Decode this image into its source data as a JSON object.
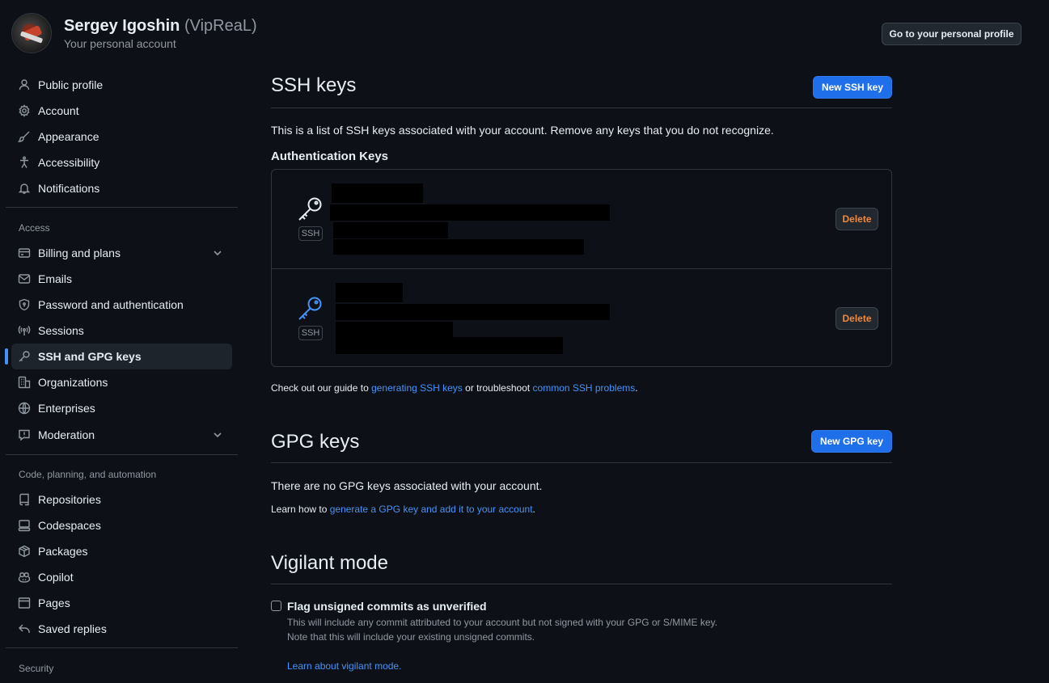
{
  "header": {
    "name": "Sergey Igoshin",
    "login": "(VipReaL)",
    "subtitle": "Your personal account",
    "profile_button": "Go to your personal profile"
  },
  "sidebar": {
    "items": [
      {
        "label": "Public profile",
        "icon": "person-icon"
      },
      {
        "label": "Account",
        "icon": "gear-icon"
      },
      {
        "label": "Appearance",
        "icon": "paintbrush-icon"
      },
      {
        "label": "Accessibility",
        "icon": "accessibility-icon"
      },
      {
        "label": "Notifications",
        "icon": "bell-icon"
      }
    ],
    "access_header": "Access",
    "access_items": [
      {
        "label": "Billing and plans",
        "icon": "credit-card-icon"
      },
      {
        "label": "Emails",
        "icon": "mail-icon"
      },
      {
        "label": "Password and authentication",
        "icon": "shield-lock-icon"
      },
      {
        "label": "Sessions",
        "icon": "broadcast-icon"
      },
      {
        "label": "SSH and GPG keys",
        "icon": "key-icon"
      },
      {
        "label": "Organizations",
        "icon": "organization-icon"
      },
      {
        "label": "Enterprises",
        "icon": "globe-icon"
      },
      {
        "label": "Moderation",
        "icon": "report-icon"
      }
    ],
    "code_header": "Code, planning, and automation",
    "code_items": [
      {
        "label": "Repositories",
        "icon": "repo-icon"
      },
      {
        "label": "Codespaces",
        "icon": "codespaces-icon"
      },
      {
        "label": "Packages",
        "icon": "package-icon"
      },
      {
        "label": "Copilot",
        "icon": "copilot-icon"
      },
      {
        "label": "Pages",
        "icon": "browser-icon"
      },
      {
        "label": "Saved replies",
        "icon": "reply-icon"
      }
    ],
    "security_header": "Security"
  },
  "ssh": {
    "title": "SSH keys",
    "new_button": "New SSH key",
    "description": "This is a list of SSH keys associated with your account. Remove any keys that you do not recognize.",
    "auth_header": "Authentication Keys",
    "keys": [
      {
        "badge": "SSH",
        "delete_label": "Delete",
        "icon_color": "#e6edf3"
      },
      {
        "badge": "SSH",
        "delete_label": "Delete",
        "icon_color": "#4493f8"
      }
    ],
    "guide_prefix": "Check out our guide to ",
    "guide_link1": "generating SSH keys",
    "guide_middle": " or troubleshoot ",
    "guide_link2": "common SSH problems",
    "guide_suffix": "."
  },
  "gpg": {
    "title": "GPG keys",
    "new_button": "New GPG key",
    "empty_text": "There are no GPG keys associated with your account.",
    "learn_prefix": "Learn how to ",
    "learn_link": "generate a GPG key and add it to your account",
    "learn_suffix": "."
  },
  "vigilant": {
    "title": "Vigilant mode",
    "checkbox_label": "Flag unsigned commits as unverified",
    "checked": false,
    "note1": "This will include any commit attributed to your account but not signed with your GPG or S/MIME key.",
    "note2": "Note that this will include your existing unsigned commits.",
    "learn_link": "Learn about vigilant mode."
  },
  "colors": {
    "background": "#0d1117",
    "accent": "#4493f8",
    "primary_button": "#1f6feb",
    "danger_text": "#f0883e"
  }
}
